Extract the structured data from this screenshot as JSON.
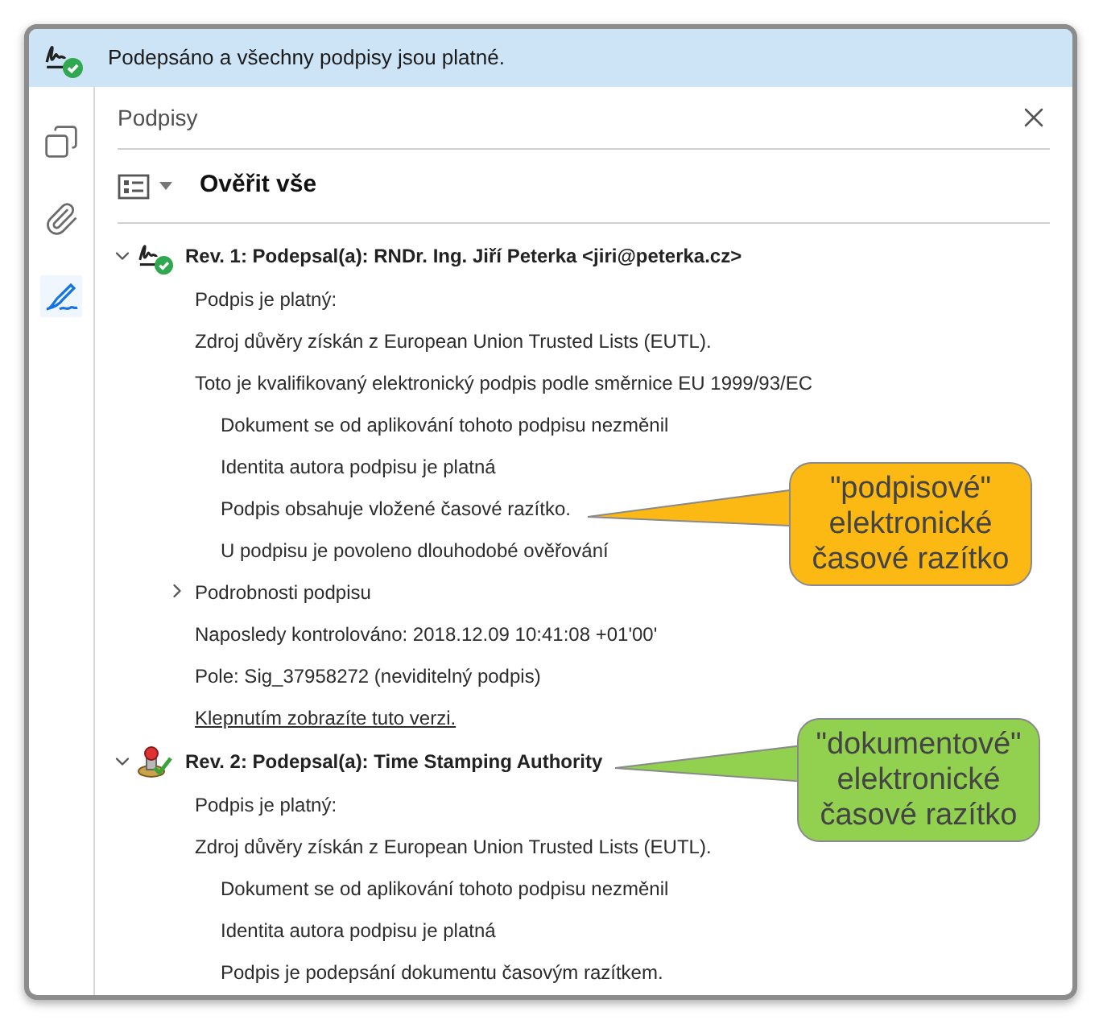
{
  "banner": {
    "text": "Podepsáno a všechny podpisy jsou platné."
  },
  "sidebar": {
    "items": [
      {
        "kind": "pages",
        "selected": false
      },
      {
        "kind": "attachments",
        "selected": false
      },
      {
        "kind": "signatures",
        "selected": true
      }
    ]
  },
  "panel": {
    "title": "Podpisy",
    "toolbar": {
      "button": "Ověřit vše"
    }
  },
  "signatures": [
    {
      "kind": "signature",
      "expanded": true,
      "header": "Rev. 1: Podepsal(a): RNDr. Ing. Jiří Peterka <jiri@peterka.cz>",
      "details": [
        {
          "kind": "line",
          "text": "Podpis je platný:"
        },
        {
          "kind": "line",
          "text": "Zdroj důvěry získán z European Union Trusted Lists (EUTL)."
        },
        {
          "kind": "line",
          "text": "Toto je kvalifikovaný elektronický podpis podle směrnice EU 1999/93/EC",
          "children": [
            {
              "kind": "line",
              "text": "Dokument se od aplikování tohoto podpisu nezměnil"
            },
            {
              "kind": "line",
              "text": "Identita autora podpisu je platná"
            },
            {
              "kind": "line",
              "text": "Podpis obsahuje vložené časové razítko."
            },
            {
              "kind": "line",
              "text": "U podpisu je povoleno dlouhodobé ověřování"
            }
          ]
        },
        {
          "kind": "expander",
          "text": "Podrobnosti podpisu",
          "expanded": false
        },
        {
          "kind": "line",
          "text": "Naposledy kontrolováno: 2018.12.09 10:41:08 +01'00'"
        },
        {
          "kind": "line",
          "text": "Pole: Sig_37958272 (neviditelný podpis)"
        },
        {
          "kind": "link",
          "text": "Klepnutím zobrazíte tuto verzi."
        }
      ]
    },
    {
      "kind": "timestamp",
      "expanded": true,
      "header": "Rev. 2: Podepsal(a): Time Stamping Authority",
      "details": [
        {
          "kind": "line",
          "text": "Podpis je platný:"
        },
        {
          "kind": "line",
          "text": "Zdroj důvěry získán z European Union Trusted Lists (EUTL).",
          "children": [
            {
              "kind": "line",
              "text": "Dokument se od aplikování tohoto podpisu nezměnil"
            },
            {
              "kind": "line",
              "text": "Identita autora podpisu je platná"
            },
            {
              "kind": "line",
              "text": "Podpis je podepsání dokumentu časovým razítkem."
            }
          ]
        }
      ]
    }
  ],
  "callouts": [
    {
      "color": "#fdb913",
      "lines": [
        "\"podpisové\"",
        "elektronické",
        "časové razítko"
      ]
    },
    {
      "color": "#92d050",
      "lines": [
        "\"dokumentové\"",
        "elektronické",
        "časové razítko"
      ]
    }
  ]
}
